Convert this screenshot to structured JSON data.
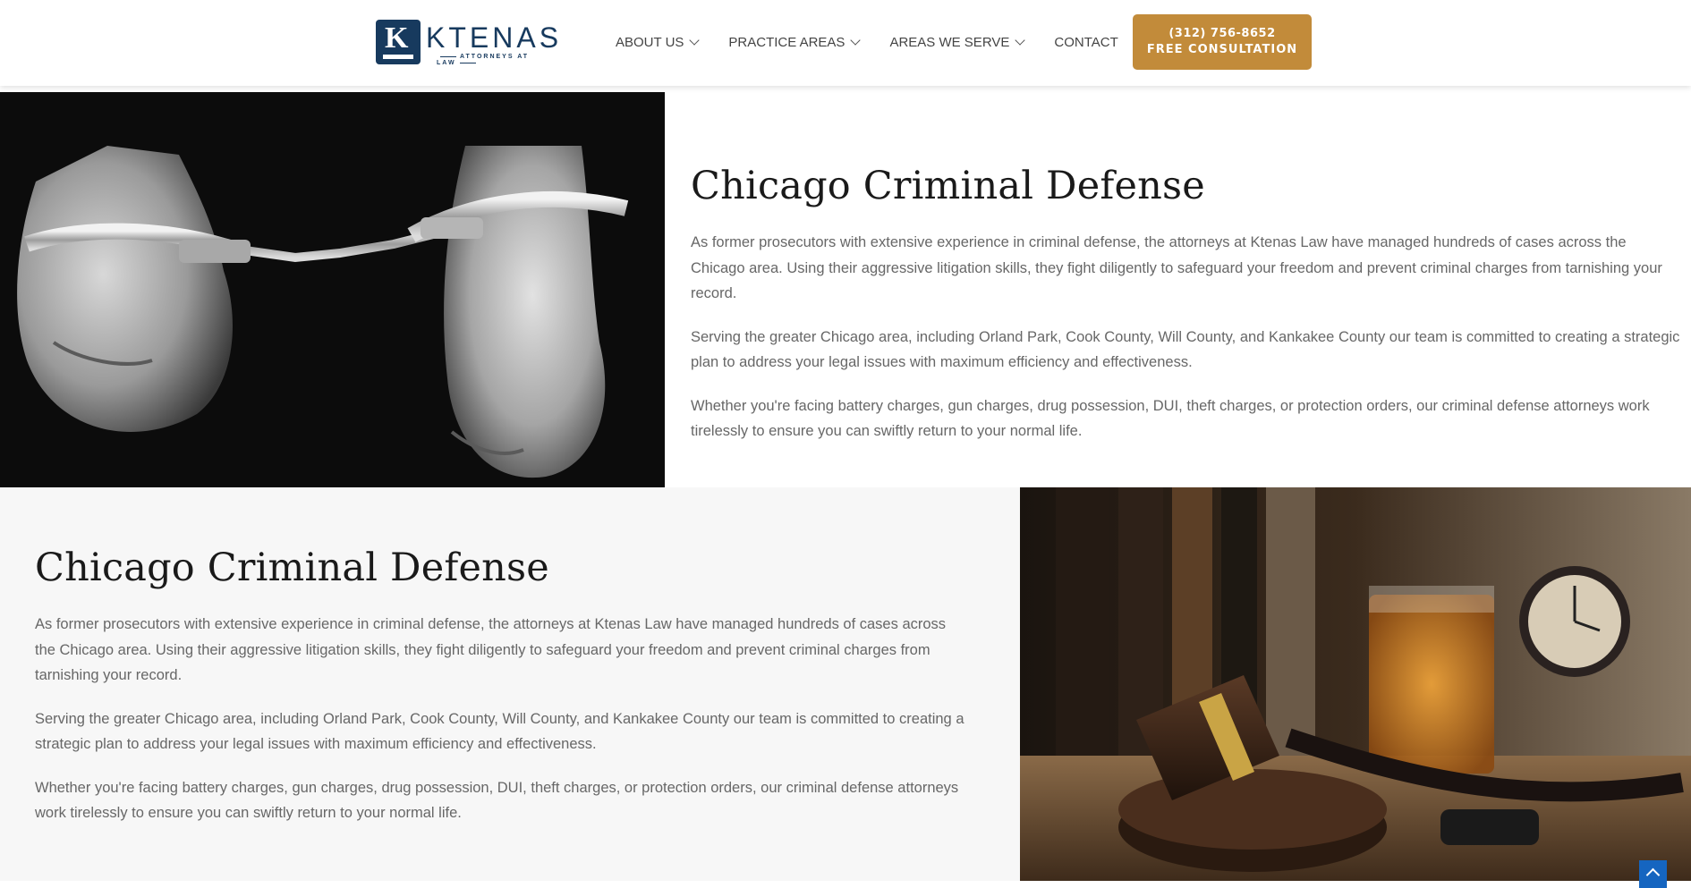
{
  "header": {
    "logo": {
      "name": "KTENAS",
      "tagline": "ATTORNEYS AT LAW",
      "letter": "K"
    },
    "nav": [
      {
        "label": "ABOUT US",
        "has_dropdown": true
      },
      {
        "label": "PRACTICE AREAS",
        "has_dropdown": true
      },
      {
        "label": "AREAS WE SERVE",
        "has_dropdown": true
      },
      {
        "label": "CONTACT",
        "has_dropdown": false
      }
    ],
    "cta": {
      "phone": "(312) 756-8652",
      "label": "FREE CONSULTATION"
    }
  },
  "section1": {
    "image": "handcuffs-photo",
    "title": "Chicago Criminal Defense",
    "paragraphs": [
      "As former prosecutors with extensive experience in criminal defense, the attorneys at Ktenas Law have managed hundreds of cases across the Chicago area. Using their aggressive litigation skills, they fight diligently to safeguard your freedom and prevent criminal charges from tarnishing your record.",
      "Serving the greater Chicago area, including Orland Park, Cook County, Will County, and Kankakee County our team is committed to creating a strategic plan to address your legal issues with maximum efficiency and effectiveness.",
      "Whether you're facing battery charges, gun charges, drug possession, DUI, theft charges, or protection orders, our criminal defense attorneys work tirelessly to ensure you can swiftly return to your normal life."
    ]
  },
  "section2": {
    "image": "gavel-whiskey-keys-photo",
    "title": "Chicago Criminal Defense",
    "paragraphs": [
      "As former prosecutors with extensive experience in criminal defense, the attorneys at Ktenas Law have managed hundreds of cases across the Chicago area. Using their aggressive litigation skills, they fight diligently to safeguard your freedom and prevent criminal charges from tarnishing your record.",
      "Serving the greater Chicago area, including Orland Park, Cook County, Will County, and Kankakee County our team is committed to creating a strategic plan to address your legal issues with maximum efficiency and effectiveness.",
      "Whether you're facing battery charges, gun charges, drug possession, DUI, theft charges, or protection orders, our criminal defense attorneys work tirelessly to ensure you can swiftly return to your normal life."
    ]
  },
  "scroll_top_icon": "arrow-up-icon",
  "colors": {
    "brand_navy": "#173a5e",
    "cta_gold": "#c28b3a",
    "scroll_blue": "#1565c0"
  }
}
